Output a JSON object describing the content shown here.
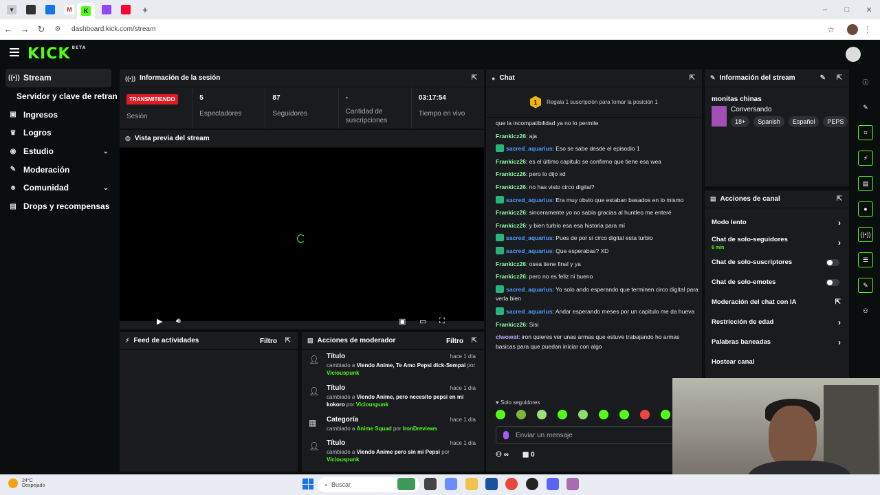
{
  "browser": {
    "url": "dashboard.kick.com/stream"
  },
  "app": {
    "logo": "KICK",
    "logo_sup": "BETA"
  },
  "sidebar": {
    "items": [
      {
        "label": "Stream",
        "icon": "broadcast-icon"
      },
      {
        "label": "Servidor y clave de retransm",
        "icon": ""
      },
      {
        "label": "Ingresos",
        "icon": "dollar-icon"
      },
      {
        "label": "Logros",
        "icon": "trophy-icon"
      },
      {
        "label": "Estudio",
        "icon": "palette-icon"
      },
      {
        "label": "Moderación",
        "icon": "wrench-icon"
      },
      {
        "label": "Comunidad",
        "icon": "people-icon"
      },
      {
        "label": "Drops y recompensas",
        "icon": "gift-icon"
      }
    ]
  },
  "session": {
    "title": "Información de la sesión",
    "live_badge": "TRANSMITIENDO",
    "session_label": "Sesión",
    "viewers_value": "5",
    "viewers_label": "Espectadores",
    "followers_value": "87",
    "followers_label": "Seguidores",
    "subs_value": "-",
    "subs_label": "Cantidad de suscripciones",
    "time_value": "03:17:54",
    "time_label": "Tiempo en vivo"
  },
  "preview": {
    "title": "Vista previa del stream"
  },
  "activity": {
    "title": "Feed de actividades",
    "filter": "Filtro"
  },
  "modactions": {
    "title": "Acciones de moderador",
    "filter": "Filtro",
    "items": [
      {
        "title": "Título",
        "date": "hace 1 día",
        "changed": "cambiado a ",
        "value": "Viendo Anime, Te Amo Pepsi dick-Sempai",
        "by": " por ",
        "user": "Viciouspunk"
      },
      {
        "title": "Título",
        "date": "hace 1 día",
        "changed": "cambiado a ",
        "value": "Viendo Anime, pero necesito pepsi en mi kokoro",
        "by": " por ",
        "user": "Viciouspunk"
      },
      {
        "title": "Categoría",
        "date": "hace 1 día",
        "changed": "cambiado a ",
        "value": "Anime Squad",
        "by": " por ",
        "user": "IronDreviews"
      },
      {
        "title": "Título",
        "date": "hace 1 día",
        "changed": "cambiado a ",
        "value": "Viendo Anime pero sin mi Pepsi",
        "by": " por ",
        "user": "Viciouspunk"
      }
    ]
  },
  "chat": {
    "title": "Chat",
    "gift_rank": "1",
    "gift_text": "Regala 1 suscripción para tomar la posición 1",
    "messages": [
      {
        "user": "",
        "cls": "",
        "badge": false,
        "text": "que la incompatibilidad ya no lo permite"
      },
      {
        "user": "Frankicz26",
        "cls": "u-f",
        "badge": false,
        "text": ": aja"
      },
      {
        "user": "sacred_aquarius",
        "cls": "u-s",
        "badge": true,
        "text": ": Eso se sabe desde el episodio 1"
      },
      {
        "user": "Frankicz26",
        "cls": "u-f",
        "badge": false,
        "text": ": es el último capitulo se confirmo que tiene esa wea"
      },
      {
        "user": "Frankicz26",
        "cls": "u-f",
        "badge": false,
        "text": ": pero lo dijo xd"
      },
      {
        "user": "Frankicz26",
        "cls": "u-f",
        "badge": false,
        "text": ": no has visto circo digital?"
      },
      {
        "user": "sacred_aquarius",
        "cls": "u-s",
        "badge": true,
        "text": ": Era muy obvio que estaban basados en lo mismo"
      },
      {
        "user": "Frankicz26",
        "cls": "u-f",
        "badge": false,
        "text": ": sinceramente yo no sabía gracias al huntleo me enteré"
      },
      {
        "user": "Frankicz26",
        "cls": "u-f",
        "badge": false,
        "text": ": y bien turbio esa esa historia para mí"
      },
      {
        "user": "sacred_aquarius",
        "cls": "u-s",
        "badge": true,
        "text": ": Pues de por si circo digital esta turbio"
      },
      {
        "user": "sacred_aquarius",
        "cls": "u-s",
        "badge": true,
        "text": ": Que esperabas? XD"
      },
      {
        "user": "Frankicz26",
        "cls": "u-f",
        "badge": false,
        "text": ": osea tiene final y ya"
      },
      {
        "user": "Frankicz26",
        "cls": "u-f",
        "badge": false,
        "text": ": pero no es feliz ni bueno"
      },
      {
        "user": "sacred_aquarius",
        "cls": "u-s",
        "badge": true,
        "text": ": Yo solo ando esperando que terminen circo digital para verla bien"
      },
      {
        "user": "sacred_aquarius",
        "cls": "u-s",
        "badge": true,
        "text": ": Andar esperando meses por un capitulo me da hueva"
      },
      {
        "user": "Frankicz26",
        "cls": "u-f",
        "badge": false,
        "text": ": Sisi"
      },
      {
        "user": "clwowat",
        "cls": "u-c",
        "badge": false,
        "text": ": iron quieres ver unas armas que estuve trabajando ho armas basicas para que puedan iniciar con algo"
      }
    ],
    "followers_only": "Solo seguidores",
    "input_placeholder": "Enviar un mensaje",
    "points_count": "0"
  },
  "stream_info": {
    "title": "Información del stream",
    "name": "monitas chinas",
    "category": "Conversando",
    "tags": [
      "18+",
      "Spanish",
      "Español",
      "PEPS"
    ]
  },
  "channel_actions": {
    "title": "Acciones de canal",
    "items": [
      {
        "label": "Modo lento",
        "control": "arrow",
        "sub": ""
      },
      {
        "label": "Chat de solo-seguidores",
        "control": "arrow",
        "sub": "6 min"
      },
      {
        "label": "Chat de solo-suscriptores",
        "control": "toggle",
        "sub": ""
      },
      {
        "label": "Chat de solo-emotes",
        "control": "toggle",
        "sub": ""
      },
      {
        "label": "Moderación del chat con IA",
        "control": "popout",
        "sub": ""
      },
      {
        "label": "Restricción de edad",
        "control": "arrow",
        "sub": ""
      },
      {
        "label": "Palabras baneadas",
        "control": "arrow",
        "sub": ""
      },
      {
        "label": "Hostear canal",
        "control": "none",
        "sub": ""
      }
    ]
  },
  "taskbar": {
    "temp": "24°C",
    "weather": "Despejado",
    "search_placeholder": "Buscar"
  },
  "colors": {
    "brand": "#53fc18",
    "live": "#e01b24",
    "panel": "#191b1f",
    "background": "#0b0e0f"
  }
}
